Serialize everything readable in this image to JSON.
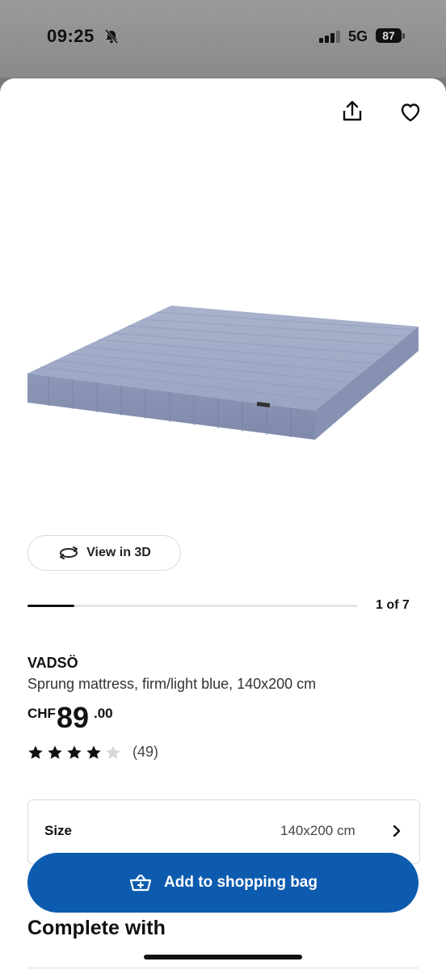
{
  "status_bar": {
    "time": "09:25",
    "network": "5G",
    "battery": "87"
  },
  "product": {
    "view_3d_label": "View in 3D",
    "carousel": {
      "position_label": "1 of 7",
      "current": 1,
      "total": 7
    },
    "brand": "VADSÖ",
    "description": "Sprung mattress, firm/light blue, 140x200 cm",
    "price": {
      "currency": "CHF",
      "whole": "89",
      "decimal": ".00"
    },
    "rating": {
      "stars": 4,
      "max": 5,
      "count_label": "(49)"
    },
    "size": {
      "label": "Size",
      "value": "140x200 cm"
    },
    "add_to_bag_label": "Add to shopping bag",
    "complete_with_title": "Complete with"
  },
  "icons": {
    "share": "share-icon",
    "favorite": "heart-icon",
    "rotate_3d": "rotate-3d-icon",
    "bag": "shopping-basket-icon",
    "chevron": "chevron-right-icon"
  },
  "colors": {
    "accent_blue": "#0d5baf",
    "star": "#111111",
    "star_empty": "#d6d6d6"
  }
}
